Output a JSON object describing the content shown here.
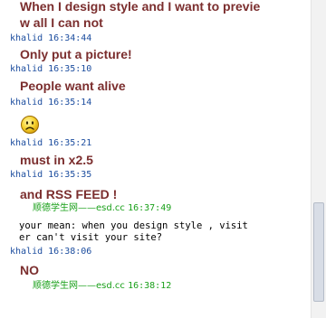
{
  "messages": {
    "m1": {
      "text": "When I design style and I want to previe\nw all I can not"
    },
    "m2": {
      "user": "khalid",
      "time": "16:34:44",
      "text": "Only put a picture!"
    },
    "m3": {
      "user": "khalid",
      "time": "16:35:10",
      "text": "People want alive"
    },
    "m4": {
      "user": "khalid",
      "time": "16:35:14",
      "emoji": "sad-face-icon"
    },
    "m5": {
      "user": "khalid",
      "time": "16:35:21",
      "text": "must in x2.5"
    },
    "m6": {
      "user": "khalid",
      "time": "16:35:35",
      "text": "and RSS FEED !"
    },
    "m7": {
      "user": "顺德学生网——esd.cc",
      "time": "16:37:49",
      "text": "your mean: when you design style , visit\ner can't visit your site?"
    },
    "m8": {
      "user": "khalid",
      "time": "16:38:06",
      "text": "NO"
    },
    "m9": {
      "user": "顺德学生网——esd.cc",
      "time": "16:38:12"
    }
  },
  "colors": {
    "khalid_name": "#1b4c9e",
    "sd_name": "#1aa01a",
    "bold_text": "#7b2e2e",
    "plain_text": "#000000"
  }
}
